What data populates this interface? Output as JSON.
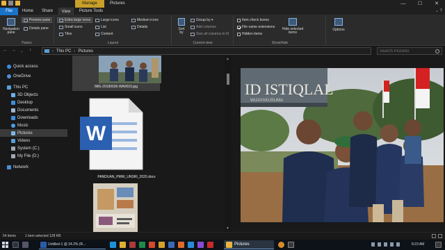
{
  "titlebar": {
    "manage": "Manage",
    "title": "Pictures",
    "minimize": "—",
    "maximize": "☐",
    "close": "✕"
  },
  "tabs": {
    "file": "File",
    "home": "Home",
    "share": "Share",
    "view": "View",
    "picture_tools": "Picture Tools",
    "help": "⌄ ?"
  },
  "ribbon": {
    "panes": {
      "label": "Panes",
      "navigation_pane": "Navigation pane",
      "preview_pane": "Preview pane",
      "details_pane": "Details pane"
    },
    "layout": {
      "label": "Layout",
      "extra_large_icons": "Extra large icons",
      "large_icons": "Large icons",
      "medium_icons": "Medium icons",
      "small_icons": "Small icons",
      "list": "List",
      "details": "Details",
      "tiles": "Tiles",
      "content": "Content"
    },
    "current_view": {
      "label": "Current view",
      "sort_by": "Sort by",
      "group_by": "Group by ▾",
      "add_columns": "Add columns",
      "size_all_columns": "Size all columns to fit"
    },
    "show_hide": {
      "label": "Show/hide",
      "item_check_boxes": "Item check boxes",
      "file_name_extensions": "File name extensions",
      "hidden_items": "Hidden items",
      "hide_selected_items": "Hide selected items",
      "options": "Options"
    }
  },
  "address": {
    "path": [
      "This PC",
      "Pictures"
    ],
    "separator": "›",
    "search_placeholder": "Search Pictures"
  },
  "nav": {
    "quick_access": "Quick access",
    "onedrive": "OneDrive",
    "this_pc": "This PC",
    "objects_3d": "3D Objects",
    "desktop": "Desktop",
    "documents": "Documents",
    "downloads": "Downloads",
    "music": "Music",
    "pictures": "Pictures",
    "videos": "Videos",
    "system_c": "System (C:)",
    "my_file_d": "My File (D:)",
    "network": "Network"
  },
  "files": [
    {
      "name": "IMG-20190026-WA0019.jpg",
      "type": "image"
    },
    {
      "name": "PANDUAN_PMW_UNSRI_2020.docx",
      "type": "word"
    }
  ],
  "preview": {
    "sign_text": "ID ISTIQLAL",
    "sign_subtext": "WIJAYAKUSUMA"
  },
  "status": {
    "count": "54 items",
    "selection": "1 item selected  128 KB"
  },
  "taskbar": {
    "untitled_app": "Untitled-1 @ 24.2% (R...",
    "pictures_app": "Pictures",
    "time": "8:23 AM"
  },
  "colors": {
    "accent": "#1a73c8",
    "manage_tab": "#c8a02a",
    "background": "#191919",
    "ribbon": "#2b2b2b"
  }
}
